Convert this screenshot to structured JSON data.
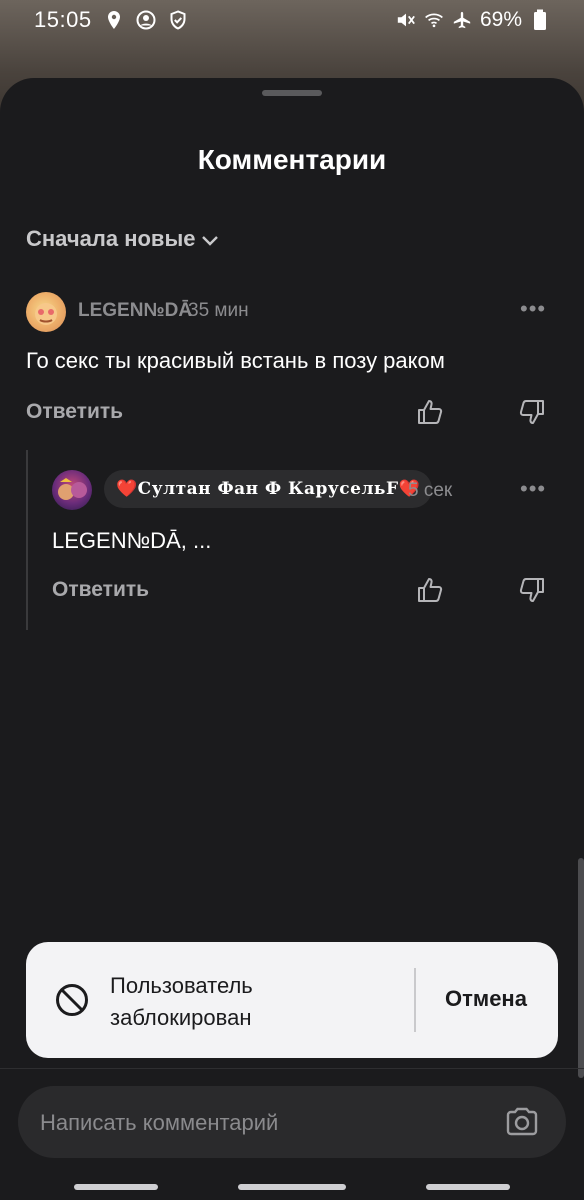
{
  "status_bar": {
    "time": "15:05",
    "battery": "69%",
    "left_icons": [
      "location-icon",
      "account-circle-icon",
      "shield-check-icon"
    ],
    "right_icons": [
      "mute-icon",
      "wifi-icon",
      "airplane-icon",
      "battery-icon"
    ]
  },
  "sheet": {
    "title": "Комментарии",
    "sort_label": "Сначала новые"
  },
  "comments": [
    {
      "username": "LEGEN№DĀ",
      "time": "35 мин",
      "text": "Го секс ты красивый встань в позу раком",
      "reply_label": "Ответить"
    },
    {
      "username": "❤️Султан Фан Ф КарусельF❤️",
      "time": "5 сек",
      "text": "LEGEN№DĀ, ...",
      "reply_label": "Ответить"
    }
  ],
  "toast": {
    "message": "Пользователь заблокирован",
    "action": "Отмена"
  },
  "composer": {
    "placeholder": "Написать комментарий"
  },
  "colors": {
    "sheet_bg": "#1b1b1d",
    "toast_bg": "#f3f3f5",
    "muted_text": "#8c8c8f"
  }
}
